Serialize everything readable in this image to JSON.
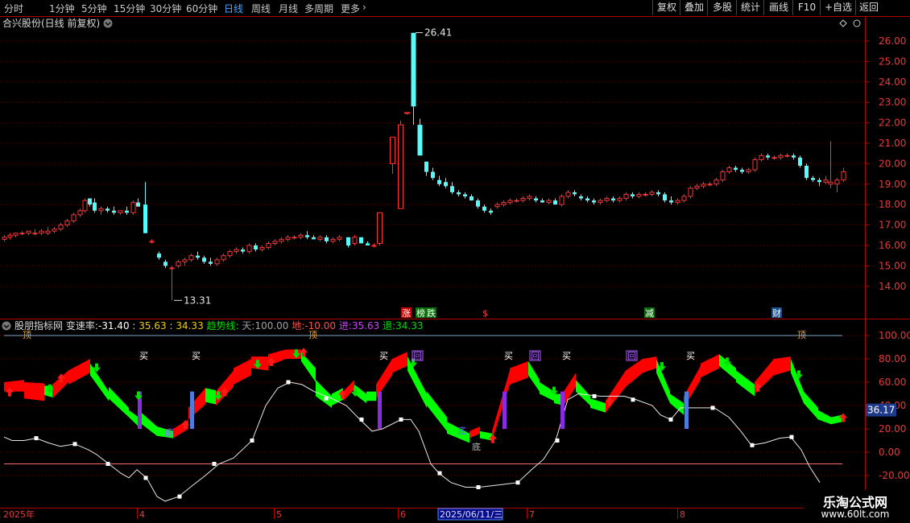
{
  "toolbar": {
    "periods": [
      "分时",
      "1分钟",
      "5分钟",
      "15分钟",
      "30分钟",
      "60分钟",
      "日线",
      "周线",
      "月线",
      "多周期",
      "更多"
    ],
    "active_index": 6,
    "more_icon": "chevron-right-icon",
    "right_buttons": [
      "复权",
      "叠加",
      "多股",
      "统计",
      "画线",
      "F10",
      "+自选",
      "返回"
    ]
  },
  "main_panel": {
    "title": "合兴股份(日线 前复权)",
    "dropdown_icon": "chevron-down-icon",
    "y_ticks": [
      "26.00",
      "25.00",
      "24.00",
      "23.00",
      "22.00",
      "21.00",
      "20.00",
      "19.00",
      "18.00",
      "17.00",
      "16.00",
      "15.00",
      "14.00"
    ],
    "high_label": "26.41",
    "low_label": "13.31",
    "markers": [
      "涨",
      "榜",
      "跌",
      "$",
      "减",
      "财"
    ],
    "candles_hex": "2b2d2e2d2f2e30332f2f3031333e3f4b5b4e4f4d4a4d4e554d4c554f5148484c4e4a4b524c5a646570716f717e7d8f8b756a716d9291885c56443c2c2326252b292c3232363a30303223211b232c2a2f3032393d3b3942434c4e4f595d5a5d6163716c6c6b76777b8186787b7e80817d7f807a7f81847d7a7d817b867d7a7d7a787d7b7d897d84797e8185887d7d80e88184818c8c8c90d9fcc9c09f9e3434b3b0b7b5e3e3e0e6e0cfd7e4a9a8baa9e4e1e9cecebbc3c0bdb5b5b1a7a7aca8b7b89c9698909b9095999bbb9f9c9e9d9ba69e9e9d989b9fa7a3a79d9fa49fa3a1a1a4a4a1a59ea2a39ea2a1a29f9d9e9da6a2a0a2a1a5a2a3a3a5a5a3a7a3a7a8a9a6a6a9a3aaadaeadabafaeb0afb0adb0b0b0aebba9bab5bcbab8a9b2c6ccc5bfc4d0cacdd3c5c7c6c2cbcdd0cdd7d1d4cfdaf7daf3cce4cbc7d6d2d6d9d3bcbcc6c7d7ccd7d4cccfd4c7cad3d0d5d3c8d7d0d8d8d4e3d5e7e3e2e8e3eae6eaf0eef0e7eee5e8e8edebf4f0f0f0edefeeece8eef0e9ecedecebe6eae8eae9e3e5e8e4e9e8e8e9ebececeaf0ecedefedeaf2f0f1f1edf3f2f3f3ebf3efeeefeeecedf0efedf0e4f0efeeefebecececf6edf6f6f4f6f4f5f3f7fffaf6fffcfe2020ffffc2c7c9c3c7c5c4c2c0bfc3c1c3c0c6c1c9c0c0c5c3c8c7c9c6c0c2c2c6c0c8c8c8cbc6cacad2ccd6ced2cfd4cfd7d4d5d6d6d6d6d3d8d8d2dad2d6d6d2d8d3d1d4d5d4d5d1d9d3d9d8d1d4d6dad7d8d8d9d8d7d8d8d9d8d8d8d8d8d9d8d7d7d6d8d7d8d8d8d4d8d7d7dad7d9d8d8d6d8dcdad7dad7d8d8d8dad8d7dad8d8d5dad8d7d9d9d9d9dadad9dad9d8d8dad7daddd6d9dad9d9d7d7d9d8d8d8d6dad4dfd6dbdcd4d6d6dddadddcd7dcd9e0dcdcdedbdbd9e2dce2dfe1e1dee2dee6e3e3e3e3e0e0e6e2e7e6e7e7e5e7e6ebe8eaeae8ebe8ebe9efedeeeeebeeeef4f2f3f1eef2f2f5f2f4f6f2f4f4f8f2f5f1f4f1f0f2f1f4f3f4f5f0f2f1f3f2f3f2f3f0f2f2f3f4f1f4f1f1f5f3f3f3eef3eef1efedeeedefeff1efebf1ebeeedeaeceaeeebeeedeaebeae9e9ebe5eaeae7e9e7e8e8eae6e8e8e8ebe7eeebecede8ebebf0edeceeebf0ecedeeebeeebeeebebeeecebeaebecebeceaedecefeaeaebe9eae7eae9e9e9eaecececede7eceaeeebeeede8ede9eceaeeebebeaecedebedeaecebeaebebebecebeaebece9e9e7e9e9e8e8eae8e7eae8e8eae6eae8e8e7e7e8e8ebe8e6e9e8e8e8e6e8e9e9ebe6e8e8e5e9e8e9e9e7e8e6ebe6e8e8e8e7e5e8e6e8e9eae7e8e8e8eae5eae9eae9e6e7eaeae8ebe8e9e9e6e8e8e8e9e5e8e8eae8e8e8e6eae7ebeaeae9ececececece9e9ebeaeae9ebebe9eaeaebeaeaeaeaeaeaebe9eae9ebeae8ebeae9eae9e9e7e8e9e9e6e9e8e7e8e7e9e9e8e8e6e9e6e7e8e5e8e8e6e8e6e7e7e6e6e3e7e5e7e6e5e7e6e6e2e5e6e6e5e4e6e7e6e6e3e7e5e5e6e5e6e6e4e6e4e5e7e4e6e6e7e4e7e6e7e6e5e7e6e4e4e4e6e6e6e6e4e4e6e6e6e5e6e6e5e6e5e5e4e6e5e5e4e4e6e3e5e3e3e5e2e5e4e5e6e4e4e6e4e4e5e5e5e6e6e6e5e4e6e6e4e6e4e4e6e5e6e6e6e7e7e6e6e6e6e6e7e8e6e7e5e6e6e6e6e6e8e7e7e7e7e7e7e7e7e8e8e9e7e9e8e9e8e9e8e8e9e9e9e8e9e8e9e9e9e9e9e8e9e9eae9eae9e9eaeae9e9eaebebe9ececeaebeae9ebebebeceaecebebebebebeceaeceeebedececedededeeecedeeeeedeeeeeeededeeeff0efeeefeeefefefefefeeeeefeef0ecefefeff0eeefefefefeff0efefefefeff1f1eff1eff0f0f0eff0f0f0f0f1f0f0eff0f1f1f1f1f2f1f0f1f0f2f1f2f2f2f1f2f2f2f2f2f2f1f1f1f1f3f1f2f2f1f3f3f3f2f2f2f3f2f3f3f3f2f3f3f1f2f3f4f3f3f3f2f4f3f4f2f4f3f3f4f2f3f4f3f4f3f5f5f4f3f3f3f3f4f3f3f4f4f3f3f3f4f2f4f4f4f4f4f4f3f5f4f5f4f4f4f4f3f4f4f4f4f5f4f3f4f3f3f4f4f3f3f5f4f3f3f4f4f5f4f4f3f4f4f3f4f4f4f4f3f4f4f3f4f4f4f3f4f4f3f3f4f4f3f5f4f4f4f4f4f4f4f3f4f4f4f3f4f3f3f3f4f4f2f3f3f3f2f3f4f3f4f3f3f3f4f3f3f3f3f3f2f3f3f4f3f3f3f2f3f2f3f3f3f2f3f2f3f2f3f3f3f3f3f3f3f2f3f3f2f3f2f2f2f2f3f2f3f3f2f3f2f2f3f3f2f2f2f3f2f2f2f2f2f1f2f2f1f2f2f2f1f2f1f1f1f2f2f1f2f1f1f1f1f1f0f1f1f1f1f0f0f0f1f1f1f1f1f0f1f0f0f0f1f0f0f0f0f0f0f0f0f0f0f0f0f0f0f0f0f0efefefefeff0f0efefefefefefeeefefeeefeeefeeefefeeeeefeeeeeeeeefeeeeeeeeeeeeeeedeeeeeeeeeeeeeeedeeeeeeededeeededededededededededededecedecedecececedecececececececececececececececebecebecebebebebebebebebebebebebebebebebebebebeaebeaeaebeaebeaeaeaeaeaeaeaeaeaeaeaeaeaeaeae9eae9e9e9e9e9eae9e9e9e9e9e9e9e9e9e9e9e9e8e9e8e8e8e8e9e8e8e8e8e8e8e8e8e8e8e8e8e8e8e8e8e8e8e7e7e8e7e7e8e7e7e7e7e7e7e7e7e7e7e7e7e6e7e7e7e7e6e7e6e6e6e6e6e6e6e6e6e6e6e6e6e6e6e6e5e6e6e6e5e5e5e6e5e5e5e5e5e5e5e5e5e5e5e5e5e5e5e4e5e4e5e4e5e4e4e4e4e4e4e4e4e4e4e4e4e4e4e4e4e4e4e4e4e3e3e4e3e3e3e3e3e3e3e3e3e3e3e3e3e3e3e3e3e3e3e3e3e3e3e3e2e2e3e2e2e2e2e2e2e2e2e2e2e2e2e2e2e2e2e2e2e2e2e2e2e2e2e2e2e1e1e1e1e1e1e1e1e1e1e1e1e1e1e1e1e1e1e1e1e1e1e1e1e1e1e1e1e1e1e1e1e1e1e1e1e0e0e0e0e0e0e0e0e0e0e0e0e0e0e0e0e0e0e0e0e0e0e0e0e0e0e0e0e0e0e0e0e0e0e0e0e0e0e0e0e0e0e0e0e0e0e0e0e0e0e0e0e0e0e0e0e0e0e0e0e0e0e0e0e0e0e0e0e0e0e0e0e0e0e0e0e0e0e0e0e0e0e0e0e0e0e0e0e0e0e0e0e0"
  },
  "indicator_panel": {
    "name": "股朋指标网",
    "dropdown_icon": "chevron-down-icon",
    "rate_label": "变速率:",
    "rate_values": [
      "-31.40",
      ":",
      "35.63",
      ":",
      "34.33"
    ],
    "trend_label": "趋势线:",
    "sky_label": "天:",
    "sky_value": "100.00",
    "ground_label": "地:",
    "ground_value": "-10.00",
    "in_label": "进:",
    "in_value": "35.63",
    "out_label": "退:",
    "out_value": "34.33",
    "y_ticks": [
      "100.00",
      "80.00",
      "60.00",
      "40.00",
      "20.00",
      "0.00",
      "-20.00"
    ],
    "current_value": "36.17",
    "signal_buy": "买",
    "signal_back": "回",
    "signal_top": "顶",
    "signal_bottom": "底"
  },
  "time_axis": {
    "labels": [
      "2025年",
      "4",
      "5",
      "6",
      "2025/06/11/三",
      "7",
      "8"
    ]
  },
  "watermark": {
    "title": "乐淘公式网",
    "url": "www.60lt.com"
  },
  "colors": {
    "up": "#ff3232",
    "down": "#54fcfc",
    "ribbon_up": "#ff0000",
    "ribbon_down": "#00ff00",
    "axis": "#b00000",
    "signal_purple": "#8a2be2",
    "signal_blue": "#4a7ddc"
  }
}
